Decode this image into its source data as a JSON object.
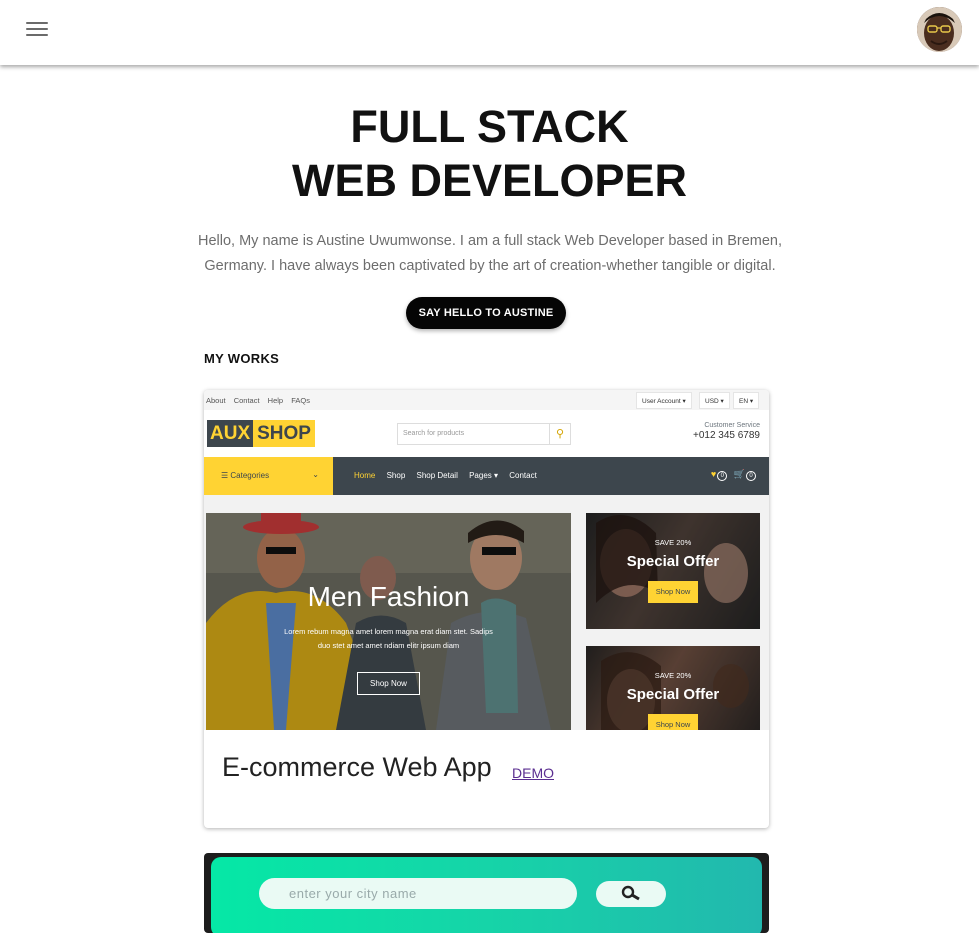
{
  "hero": {
    "title_line1": "FULL STACK",
    "title_line2": "WEB DEVELOPER",
    "intro": "Hello, My name is Austine Uwumwonse. I am a full stack Web Developer based in Bremen, Germany. I have always been captivated by the art of creation-whether tangible or digital.",
    "cta_label": "SAY HELLO TO AUSTINE"
  },
  "works": {
    "section_title": "MY WORKS",
    "projects": [
      {
        "title": "E-commerce Web App",
        "demo_label": "DEMO",
        "screenshot": {
          "top_links": [
            "About",
            "Contact",
            "Help",
            "FAQs"
          ],
          "account_label": "User Account ▾",
          "currency_label": "USD ▾",
          "language_label": "EN ▾",
          "logo_part1": "AUX",
          "logo_part2": "SHOP",
          "search_placeholder": "Search for products",
          "customer_service_label": "Customer Service",
          "phone": "+012 345 6789",
          "categories_label": "☰ Categories",
          "nav_links": [
            "Home",
            "Shop",
            "Shop Detail",
            "Pages ▾",
            "Contact"
          ],
          "wishlist_count": "0",
          "cart_count": "0",
          "carousel_title": "Men Fashion",
          "carousel_text_line1": "Lorem rebum magna amet lorem magna erat diam stet. Sadips",
          "carousel_text_line2": "duo stet amet amet ndiam elitr ipsum diam",
          "carousel_button": "Shop Now",
          "offer1": {
            "tag": "SAVE 20%",
            "title": "Special Offer",
            "button": "Shop Now"
          },
          "offer2": {
            "tag": "SAVE 20%",
            "title": "Special Offer",
            "button": "Shop Now"
          }
        }
      },
      {
        "screenshot": {
          "city_placeholder": "enter your city name"
        }
      }
    ]
  },
  "icons": {
    "menu": "hamburger-menu-icon",
    "profile": "avatar",
    "search": "search-icon",
    "wishlist": "heart-icon",
    "cart": "cart-icon"
  },
  "colors": {
    "cta_bg": "#050505",
    "shop_yellow": "#ffd333",
    "shop_dark": "#3d464d",
    "link_purple": "#5a2d90",
    "weather_green": "#05e8a6"
  }
}
